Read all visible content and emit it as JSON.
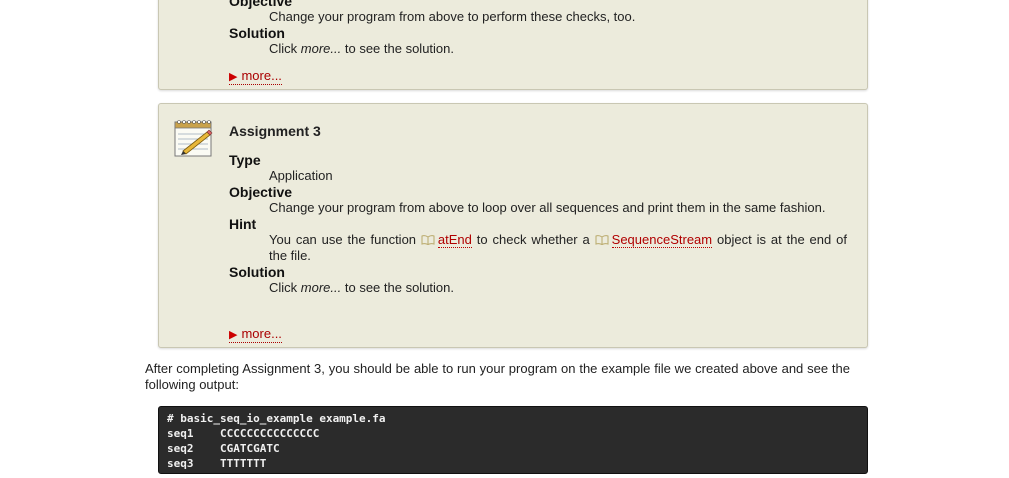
{
  "assignment2": {
    "objective_label": "Objective",
    "objective_text": "Change your program from above to perform these checks, too.",
    "solution_label": "Solution",
    "solution_prefix": "Click ",
    "solution_em": "more...",
    "solution_suffix": " to see the solution.",
    "more_label": "more..."
  },
  "assignment3": {
    "title": "Assignment 3",
    "type_label": "Type",
    "type_text": "Application",
    "objective_label": "Objective",
    "objective_text": "Change your program from above to loop over all sequences and print them in the same fashion.",
    "hint_label": "Hint",
    "hint_prefix": "You can use the function ",
    "hint_link1": "atEnd",
    "hint_mid": " to check whether a ",
    "hint_link2": "SequenceStream",
    "hint_suffix": " object is at the end of the file.",
    "solution_label": "Solution",
    "solution_prefix": "Click ",
    "solution_em": "more...",
    "solution_suffix": " to see the solution.",
    "more_label": "more..."
  },
  "intro_text": "After completing Assignment 3, you should be able to run your program on the example file we created above and see the following output:",
  "code_lines": [
    "# basic_seq_io_example example.fa",
    "seq1    CCCCCCCCCCCCCCC",
    "seq2    CGATCGATC",
    "seq3    TTTTTTT"
  ]
}
